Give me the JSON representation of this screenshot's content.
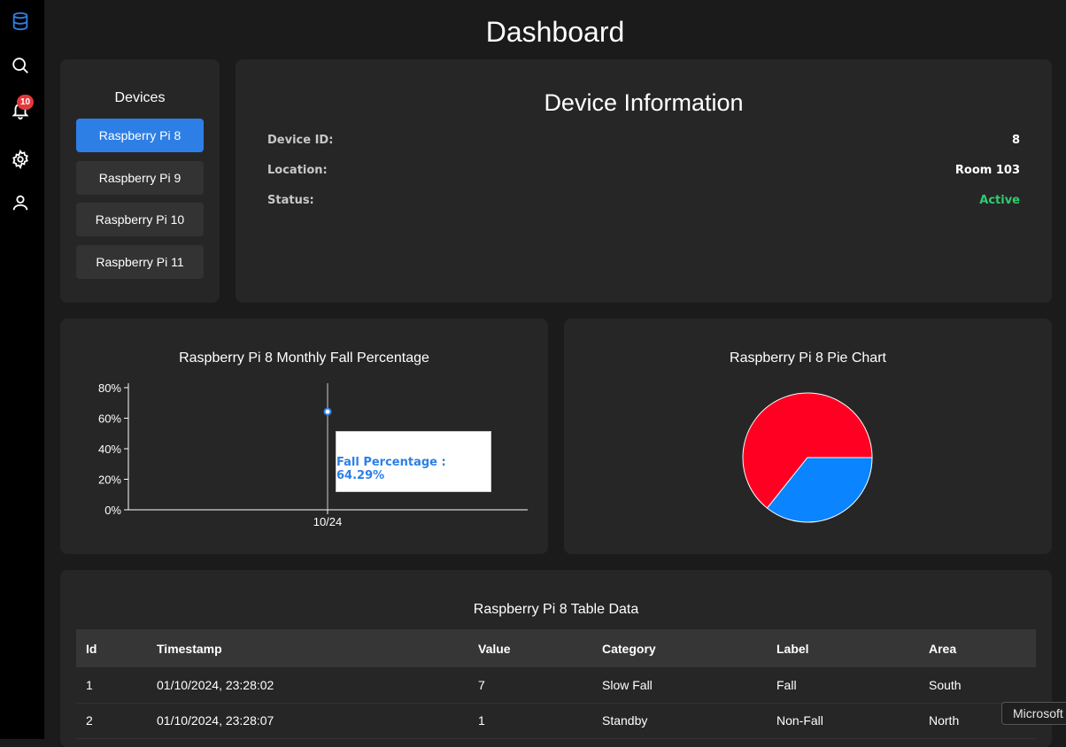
{
  "page": {
    "title": "Dashboard"
  },
  "sidebar": {
    "icons": [
      "database-icon",
      "search-icon",
      "bell-icon",
      "gear-icon",
      "user-icon"
    ],
    "notification_count": "10",
    "accent": "#2d7fe6"
  },
  "devices": {
    "title": "Devices",
    "selected": 0,
    "items": [
      {
        "label": "Raspberry Pi 8"
      },
      {
        "label": "Raspberry Pi 9"
      },
      {
        "label": "Raspberry Pi 10"
      },
      {
        "label": "Raspberry Pi 11"
      }
    ]
  },
  "device_info": {
    "title": "Device Information",
    "rows": [
      {
        "key": "Device ID:",
        "value": "8"
      },
      {
        "key": "Location:",
        "value": "Room 103"
      },
      {
        "key": "Status:",
        "value": "Active"
      }
    ],
    "status_color": "#2ecc71"
  },
  "line_chart": {
    "title": "Raspberry Pi 8 Monthly Fall Percentage",
    "tooltip": "Fall Percentage : 64.29%"
  },
  "pie_chart": {
    "title": "Raspberry Pi 8 Pie Chart"
  },
  "chart_data": [
    {
      "type": "line",
      "title": "Raspberry Pi 8 Monthly Fall Percentage",
      "x": [
        "10/24"
      ],
      "series": [
        {
          "name": "Fall Percentage",
          "values": [
            64.29
          ]
        }
      ],
      "yticks": [
        "0%",
        "20%",
        "40%",
        "60%",
        "80%"
      ],
      "ylim": [
        0,
        80
      ],
      "color": "#2d7fe6"
    },
    {
      "type": "pie",
      "title": "Raspberry Pi 8 Pie Chart",
      "slices": [
        {
          "value": 64.29,
          "color": "#ff0022"
        },
        {
          "value": 35.71,
          "color": "#0a84ff"
        }
      ]
    }
  ],
  "table": {
    "title": "Raspberry Pi 8 Table Data",
    "columns": [
      "Id",
      "Timestamp",
      "Value",
      "Category",
      "Label",
      "Area"
    ],
    "rows": [
      [
        "1",
        "01/10/2024, 23:28:02",
        "7",
        "Slow Fall",
        "Fall",
        "South"
      ],
      [
        "2",
        "01/10/2024, 23:28:07",
        "1",
        "Standby",
        "Non-Fall",
        "North"
      ]
    ]
  },
  "system_tooltip": "Microsoft"
}
